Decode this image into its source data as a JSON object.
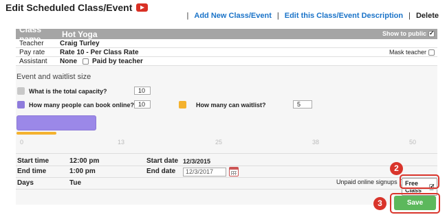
{
  "header": {
    "title": "Edit Scheduled Class/Event",
    "video_icon": "youtube-play-icon",
    "links": {
      "add_new": "Add New Class/Event",
      "edit_description": "Edit this Class/Event Description",
      "delete": "Delete"
    },
    "separator": "|"
  },
  "panel": {
    "class_name_label": "Class name",
    "class_name_value": "Hot Yoga",
    "show_to_public_label": "Show to public",
    "show_to_public_checked": true,
    "rows": {
      "teacher_label": "Teacher",
      "teacher_value": "Craig Turley",
      "pay_rate_label": "Pay rate",
      "pay_rate_value": "Rate 10 - Per Class Rate",
      "assistant_label": "Assistant",
      "assistant_value": "None",
      "paid_by_teacher_label": "Paid by teacher",
      "mask_teacher_label": "Mask teacher"
    },
    "capacity": {
      "section_title": "Event and waitlist size",
      "total_capacity_q": "What is the total capacity?",
      "total_capacity_value": "10",
      "online_q": "How many people can book online?",
      "online_value": "10",
      "waitlist_q": "How many can waitlist?",
      "waitlist_value": "5",
      "colors": {
        "total": "#c8c8c8",
        "online": "#8e7bdc",
        "waitlist": "#f4b22e"
      },
      "scale": [
        "0",
        "13",
        "25",
        "38",
        "50"
      ]
    },
    "schedule": {
      "start_time_label": "Start time",
      "start_time_value": "12:00 pm",
      "end_time_label": "End time",
      "end_time_value": "1:00 pm",
      "days_label": "Days",
      "days_value": "Tue",
      "start_date_label": "Start date",
      "start_date_value": "12/3/2015",
      "end_date_label": "End date",
      "end_date_value": "12/3/2017",
      "unpaid_signups_label": "Unpaid online signups",
      "free_class_label": "Free Class",
      "free_class_checked": true
    }
  },
  "annotations": {
    "step_2": "2",
    "step_3": "3",
    "highlight_color": "#d9342b"
  },
  "save_label": "Save"
}
